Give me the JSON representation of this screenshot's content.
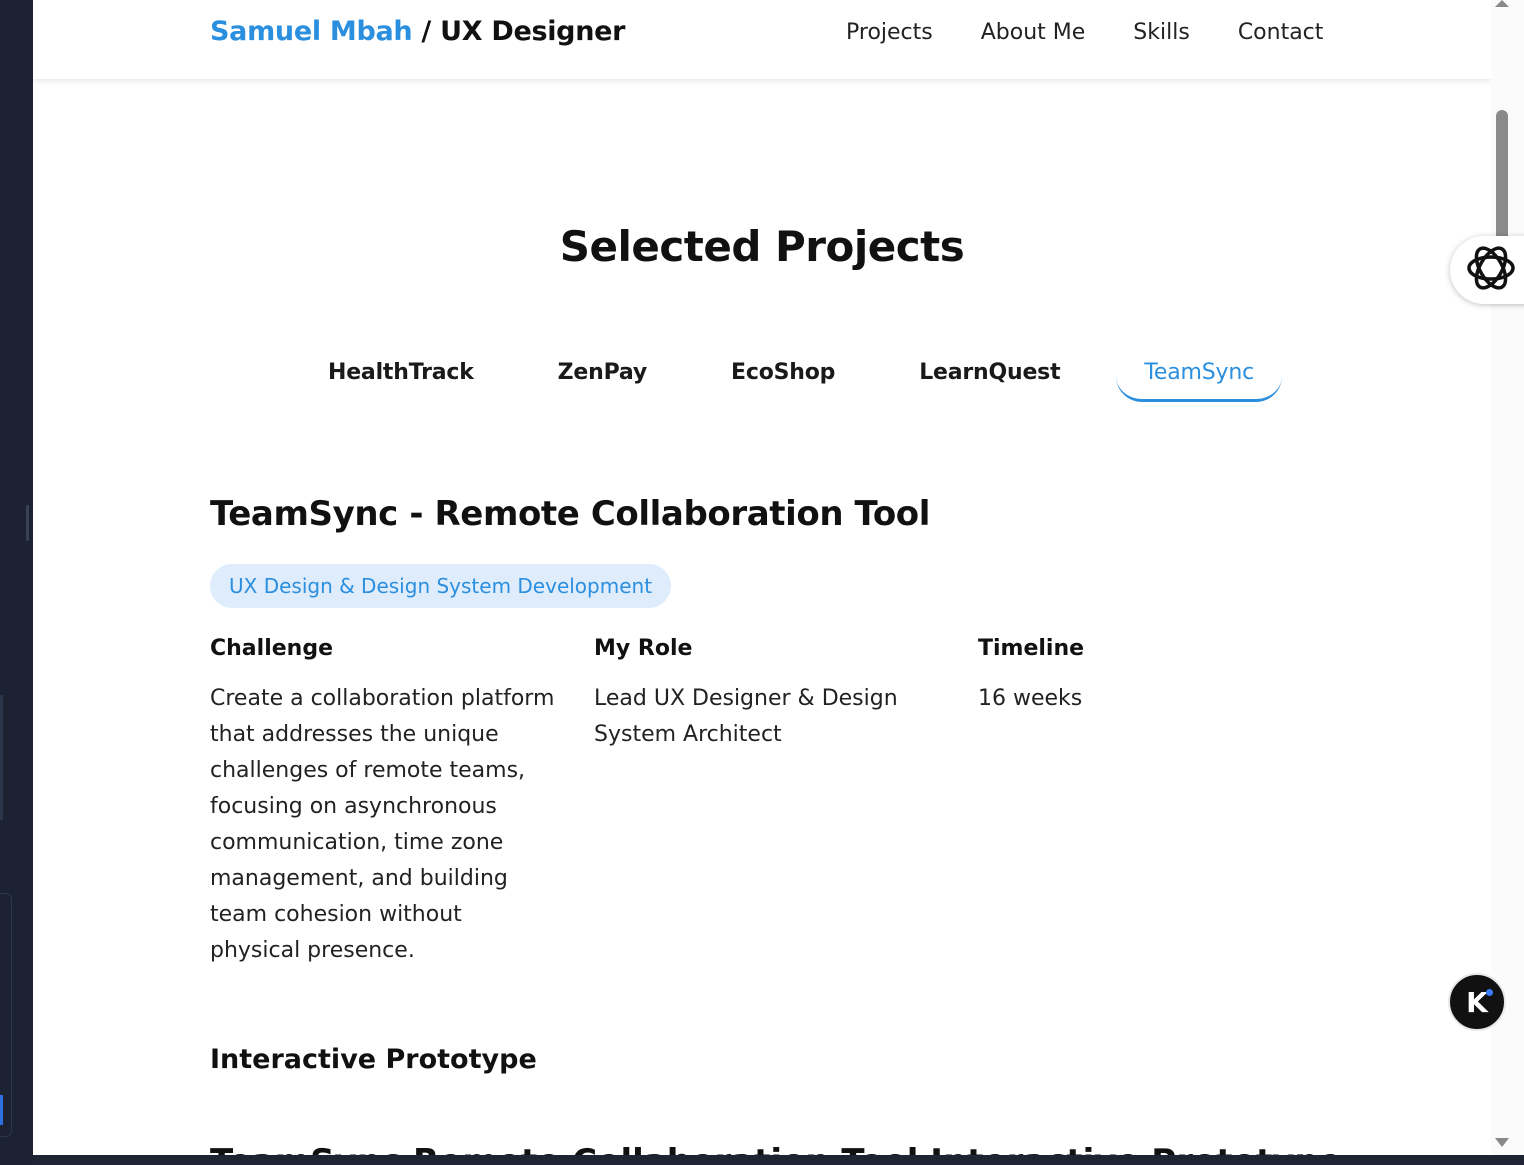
{
  "header": {
    "brand_name": "Samuel Mbah",
    "brand_separator": " / ",
    "brand_role": "UX Designer",
    "nav": [
      "Projects",
      "About Me",
      "Skills",
      "Contact"
    ]
  },
  "section": {
    "title": "Selected Projects"
  },
  "tabs": [
    {
      "label": "HealthTrack",
      "active": false
    },
    {
      "label": "ZenPay",
      "active": false
    },
    {
      "label": "EcoShop",
      "active": false
    },
    {
      "label": "LearnQuest",
      "active": false
    },
    {
      "label": "TeamSync",
      "active": true
    }
  ],
  "project": {
    "title": "TeamSync - Remote Collaboration Tool",
    "badge": "UX Design & Design System Development",
    "challenge_heading": "Challenge",
    "challenge_text": "Create a collaboration platform that addresses the unique challenges of remote teams, focusing on asynchronous communication, time zone management, and building team cohesion without physical presence.",
    "role_heading": "My Role",
    "role_text": "Lead UX Designer & Design System Architect",
    "timeline_heading": "Timeline",
    "timeline_text": "16 weeks",
    "prototype_heading": "Interactive Prototype",
    "next_heading_partial": "TeamSync Remote Collaboration Tool Interactive Prototype"
  },
  "colors": {
    "accent": "#2b8fe0",
    "badge_bg": "#deecfb"
  },
  "icons": {
    "extension": "openai-knot-icon",
    "fab": "k-assistant-icon"
  }
}
